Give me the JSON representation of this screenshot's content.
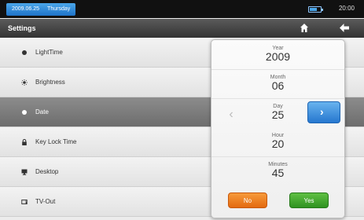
{
  "status_bar": {
    "date": "2009.06.25",
    "weekday": "Thursday",
    "time": "20:00"
  },
  "header": {
    "title": "Settings"
  },
  "settings_items": [
    {
      "label": "LightTime",
      "icon": "dot-icon"
    },
    {
      "label": "Brightness",
      "icon": "sun-icon"
    },
    {
      "label": "Date",
      "icon": "dot-icon",
      "selected": true
    },
    {
      "label": "Key Lock Time",
      "icon": "lock-icon"
    },
    {
      "label": "Desktop",
      "icon": "desktop-icon"
    },
    {
      "label": "TV-Out",
      "icon": "tv-icon"
    }
  ],
  "date_picker": {
    "fields": [
      {
        "name": "Year",
        "value": "2009"
      },
      {
        "name": "Month",
        "value": "06"
      },
      {
        "name": "Day",
        "value": "25"
      },
      {
        "name": "Hour",
        "value": "20"
      },
      {
        "name": "Minutes",
        "value": "45"
      }
    ],
    "no_label": "No",
    "yes_label": "Yes"
  },
  "colors": {
    "accent": "#2677cf",
    "selected_row": "#7a7a7a",
    "no": "#e36a10",
    "yes": "#2f9221"
  }
}
